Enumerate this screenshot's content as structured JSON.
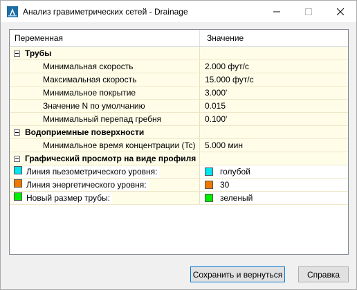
{
  "window": {
    "title": "Анализ гравиметрических сетей - Drainage",
    "minimize_glyph": "—",
    "maximize_glyph": "☐",
    "close_glyph": "✕"
  },
  "grid": {
    "headers": {
      "variable": "Переменная",
      "value": "Значение"
    },
    "categories": [
      {
        "label": "Трубы",
        "items": [
          {
            "label": "Минимальная скорость",
            "value": "2.000 фут/с"
          },
          {
            "label": "Максимальная скорость",
            "value": "15.000 фут/с"
          },
          {
            "label": "Минимальное покрытие",
            "value": "3.000'"
          },
          {
            "label": "Значение N по умолчанию",
            "value": "0.015"
          },
          {
            "label": "Минимальный перепад гребня",
            "value": "0.100'"
          }
        ]
      },
      {
        "label": "Водоприемные поверхности",
        "items": [
          {
            "label": "Минимальное время концентрации (Tc)",
            "value": "5.000 мин"
          }
        ]
      },
      {
        "label": "Графический просмотр на виде профиля",
        "items": [
          {
            "label": "Линия пьезометрического уровня:",
            "value": "голубой",
            "color": "#00e5ee"
          },
          {
            "label": "Линия энергетического уровня:",
            "value": "30",
            "color": "#f07800"
          },
          {
            "label": "Новый размер трубы:",
            "value": "зеленый",
            "color": "#00ee00"
          }
        ]
      }
    ]
  },
  "buttons": {
    "save": "Сохранить и вернуться",
    "help": "Справка"
  },
  "colors": {
    "accent": "#0078d7",
    "row_background": "#fffde8"
  },
  "icons": {
    "app": "autocad-civil-app-icon",
    "expander": "collapse-minus-icon"
  }
}
